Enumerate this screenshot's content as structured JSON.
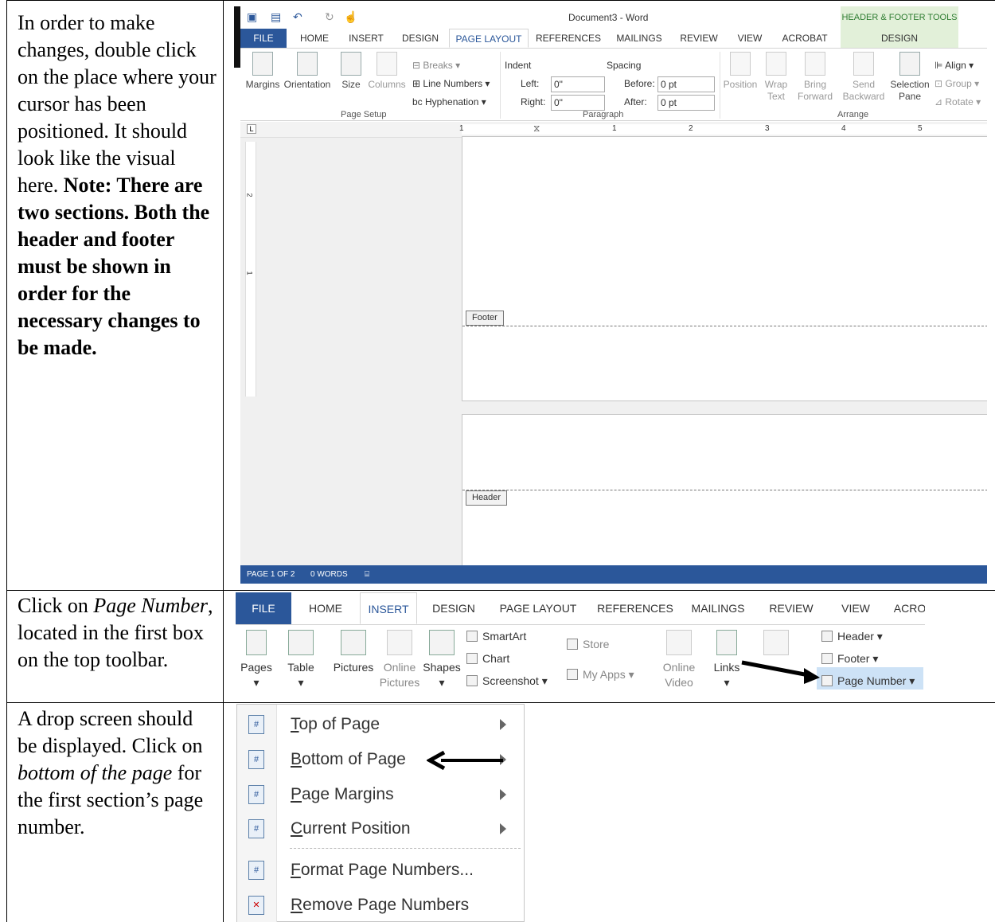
{
  "rows": [
    {
      "instruction_html": "In order to make changes, double click on the place where your cursor has been positioned. It should look like the visual here.",
      "note": "Note: There are two sections.  Both the header and footer must be shown in order for the necessary changes to be made."
    },
    {
      "instruction_parts": [
        "Click on ",
        "Page Number",
        ", located in the first box on the top toolbar."
      ]
    },
    {
      "instruction_parts": [
        "A drop screen should be displayed. Click on ",
        "bottom of the page",
        " for the first section’s page number."
      ]
    }
  ],
  "shot1": {
    "window_title": "Document3 - Word",
    "contextual_group": "HEADER & FOOTER TOOLS",
    "tabs": [
      "FILE",
      "HOME",
      "INSERT",
      "DESIGN",
      "PAGE LAYOUT",
      "REFERENCES",
      "MAILINGS",
      "REVIEW",
      "VIEW",
      "ACROBAT"
    ],
    "contextual_tab": "DESIGN",
    "page_setup": {
      "margins": "Margins",
      "orientation": "Orientation",
      "size": "Size",
      "columns": "Columns",
      "breaks": "Breaks",
      "line_numbers": "Line Numbers",
      "hyphenation": "Hyphenation",
      "group": "Page Setup"
    },
    "paragraph": {
      "indent": "Indent",
      "spacing": "Spacing",
      "left_label": "Left:",
      "left_value": "0\"",
      "right_label": "Right:",
      "right_value": "0\"",
      "before_label": "Before:",
      "before_value": "0 pt",
      "after_label": "After:",
      "after_value": "0 pt",
      "group": "Paragraph"
    },
    "arrange": {
      "position": "Position",
      "wrap": "Wrap",
      "wrap2": "Text",
      "bring": "Bring",
      "bring2": "Forward",
      "send": "Send",
      "send2": "Backward",
      "selection": "Selection",
      "selection2": "Pane",
      "align": "Align",
      "group_btn": "Group",
      "rotate": "Rotate",
      "group": "Arrange"
    },
    "ruler_numbers": [
      "1",
      "1",
      "2",
      "3",
      "4",
      "5"
    ],
    "vruler_numbers": [
      "2",
      "1"
    ],
    "footer_label": "Footer",
    "header_label": "Header",
    "status": {
      "page": "PAGE 1 OF 2",
      "words": "0 WORDS"
    }
  },
  "shot2": {
    "tabs": [
      "FILE",
      "HOME",
      "INSERT",
      "DESIGN",
      "PAGE LAYOUT",
      "REFERENCES",
      "MAILINGS",
      "REVIEW",
      "VIEW",
      "ACRO"
    ],
    "pages": "Pages",
    "table": "Table",
    "pictures": "Pictures",
    "online_pictures": "Online",
    "online_pictures2": "Pictures",
    "shapes": "Shapes",
    "smartart": "SmartArt",
    "chart": "Chart",
    "screenshot": "Screenshot",
    "store": "Store",
    "my_apps": "My Apps",
    "online_video": "Online",
    "online_video2": "Video",
    "links": "Links",
    "header": "Header",
    "footer": "Footer",
    "page_number": "Page Number"
  },
  "menu": {
    "items": [
      {
        "pre": "",
        "u": "T",
        "post": "op of Page"
      },
      {
        "pre": "",
        "u": "B",
        "post": "ottom of Page"
      },
      {
        "pre": "",
        "u": "P",
        "post": "age Margins"
      },
      {
        "pre": "",
        "u": "C",
        "post": "urrent Position"
      },
      {
        "pre": "",
        "u": "F",
        "post": "ormat Page Numbers..."
      },
      {
        "pre": "",
        "u": "R",
        "post": "emove Page Numbers"
      }
    ]
  }
}
